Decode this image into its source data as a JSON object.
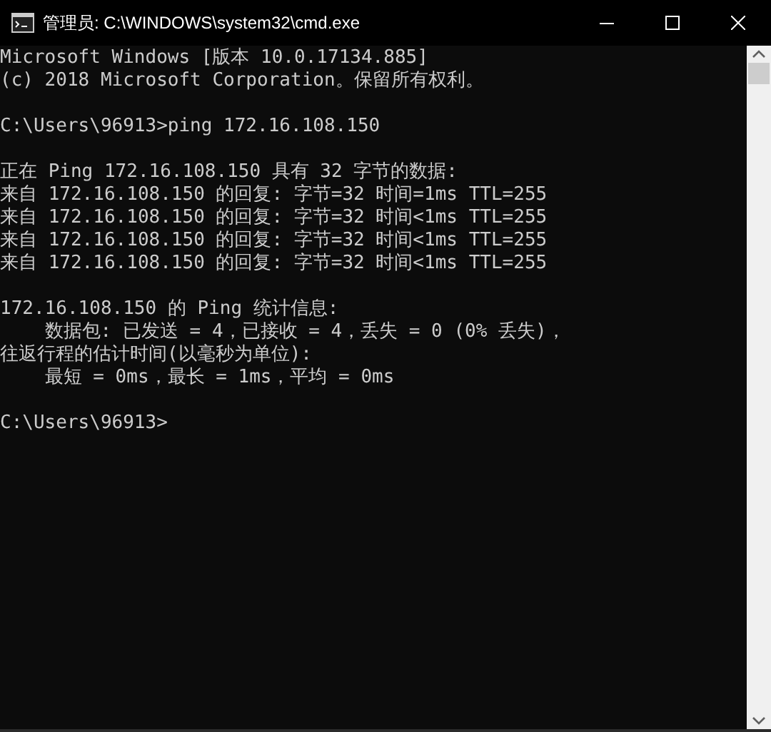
{
  "window": {
    "title": "管理员: C:\\WINDOWS\\system32\\cmd.exe"
  },
  "console": {
    "blocks": [
      [
        "Microsoft Windows [版本 10.0.17134.885]",
        "(c) 2018 Microsoft Corporation。保留所有权利。"
      ],
      [
        "C:\\Users\\96913>ping 172.16.108.150"
      ],
      [
        "正在 Ping 172.16.108.150 具有 32 字节的数据:",
        "来自 172.16.108.150 的回复: 字节=32 时间=1ms TTL=255",
        "来自 172.16.108.150 的回复: 字节=32 时间<1ms TTL=255",
        "来自 172.16.108.150 的回复: 字节=32 时间<1ms TTL=255",
        "来自 172.16.108.150 的回复: 字节=32 时间<1ms TTL=255"
      ],
      [
        "172.16.108.150 的 Ping 统计信息:",
        "    数据包: 已发送 = 4，已接收 = 4，丢失 = 0 (0% 丢失)，",
        "往返行程的估计时间(以毫秒为单位):",
        "    最短 = 0ms，最长 = 1ms，平均 = 0ms"
      ],
      [
        "C:\\Users\\96913>"
      ]
    ]
  }
}
